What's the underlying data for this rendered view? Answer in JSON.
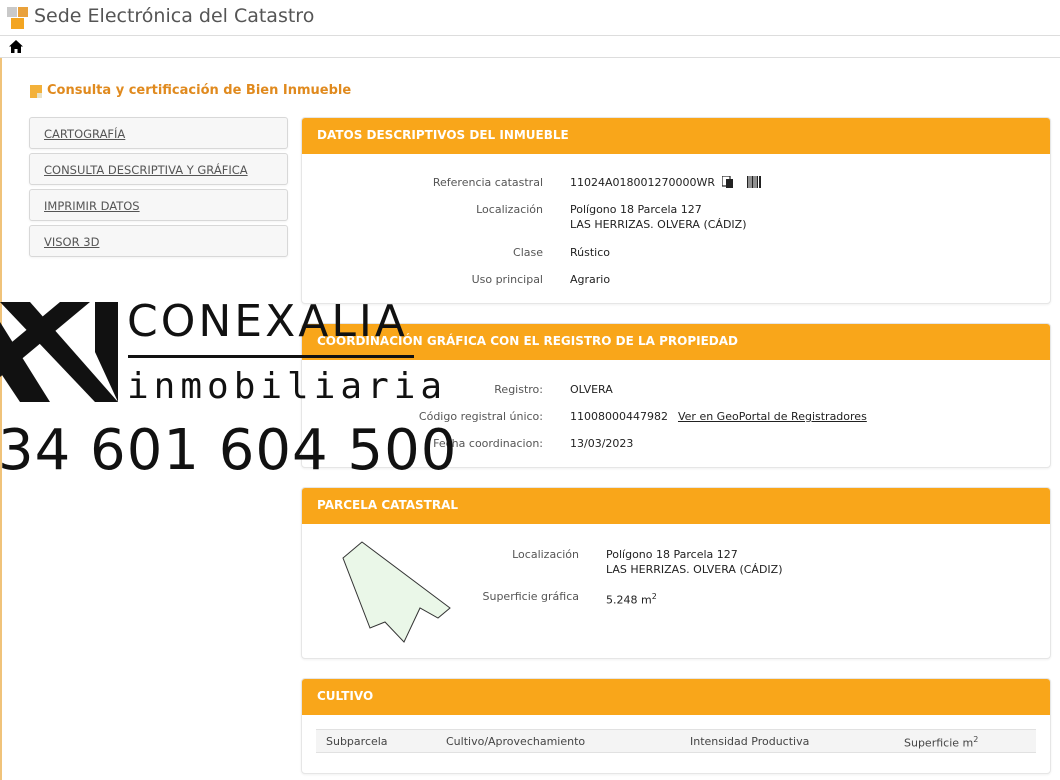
{
  "header": {
    "site_title": "Sede Electrónica del Catastro"
  },
  "nav": {
    "home_icon": "home-icon"
  },
  "page": {
    "title": "Consulta y certificación de Bien Inmueble"
  },
  "menu": {
    "items": [
      {
        "label": "CARTOGRAFÍA"
      },
      {
        "label": "CONSULTA DESCRIPTIVA Y GRÁFICA"
      },
      {
        "label": "IMPRIMIR DATOS"
      },
      {
        "label": "VISOR 3D"
      }
    ]
  },
  "datos": {
    "header": "DATOS DESCRIPTIVOS DEL INMUEBLE",
    "ref_label": "Referencia catastral",
    "ref_value": "11024A018001270000WR",
    "loc_label": "Localización",
    "loc_line1": "Polígono 18 Parcela 127",
    "loc_line2": "LAS HERRIZAS. OLVERA (CÁDIZ)",
    "clase_label": "Clase",
    "clase_value": "Rústico",
    "uso_label": "Uso principal",
    "uso_value": "Agrario"
  },
  "coordinacion": {
    "header": "COORDINACIÓN GRÁFICA CON EL REGISTRO DE LA PROPIEDAD",
    "registro_label": "Registro:",
    "registro_value": "OLVERA",
    "codigo_label": "Código registral único:",
    "codigo_value": "11008000447982",
    "geoportal_link": "Ver en GeoPortal de Registradores",
    "fecha_label": "Fecha coordinacion:",
    "fecha_value": "13/03/2023"
  },
  "parcela": {
    "header": "PARCELA CATASTRAL",
    "loc_label": "Localización",
    "loc_line1": "Polígono 18 Parcela 127",
    "loc_line2": "LAS HERRIZAS. OLVERA (CÁDIZ)",
    "sup_label": "Superficie gráfica",
    "sup_value": "5.248 m",
    "sup_unit_sup": "2"
  },
  "cultivo": {
    "header": "CULTIVO",
    "columns": [
      "Subparcela",
      "Cultivo/Aprovechamiento",
      "Intensidad Productiva",
      "Superficie m"
    ],
    "col_sup": "2"
  },
  "watermark": {
    "brand": "CONEXALIA",
    "sub": "inmobiliaria",
    "phone": "34 601 604 500"
  },
  "colors": {
    "accent": "#f9a61a",
    "title_orange": "#e08a1e",
    "parcel_fill": "#eaf7e8"
  }
}
